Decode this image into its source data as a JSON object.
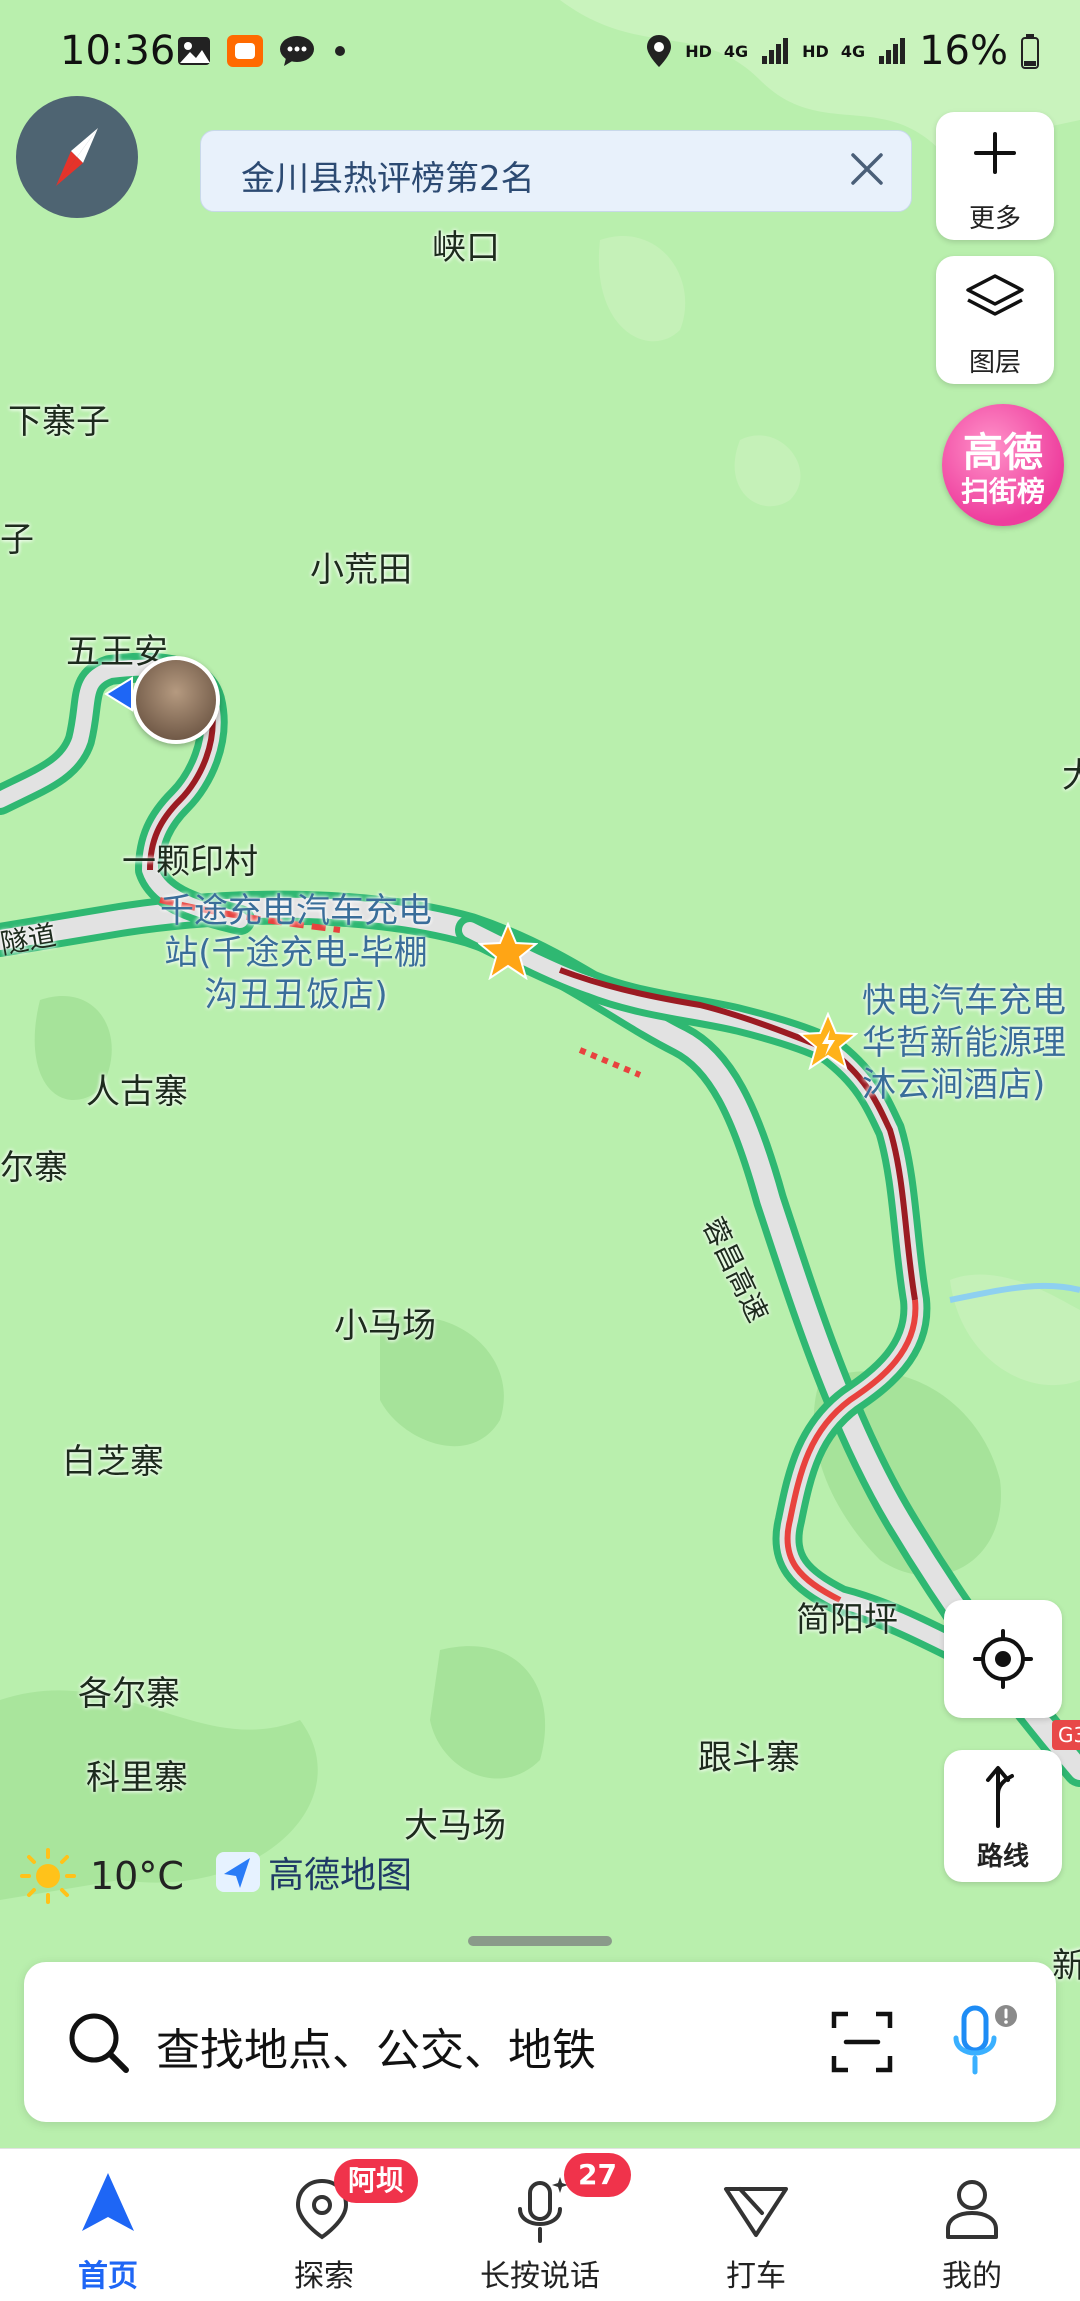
{
  "status_bar": {
    "time": "10:36",
    "network_hd_1": "HD",
    "network_4g_1": "4G",
    "network_hd_2": "HD",
    "network_4g_2": "4G",
    "battery": "16%"
  },
  "banner": {
    "text": "金川县热评榜第2名"
  },
  "side_buttons": {
    "more": "更多",
    "layers": "图层",
    "locate": "",
    "route": "路线"
  },
  "gaode_badge": {
    "line1": "高德",
    "line2": "扫街榜"
  },
  "map_labels": {
    "xiakou": "峡口",
    "xiazhaizi": "下寨子",
    "zi": "子",
    "xiaohuangtian": "小荒田",
    "wuwangan": "五王安",
    "yikeyincun": "一颗印村",
    "suidao": "隧道",
    "rengzhai": "人古寨",
    "erzhai": "尔寨",
    "xiaomachang": "小马场",
    "baizhizhai": "白芝寨",
    "geerzhai": "各尔寨",
    "kelizhai": "科里寨",
    "damachang": "大马场",
    "gendouzhai": "跟斗寨",
    "jianyangping": "简阳坪",
    "highway": "蓉昌高速",
    "da_edge": "大",
    "xin_edge": "新",
    "g_edge": "G3"
  },
  "pois": {
    "qiantu_1": "千途充电汽车充电",
    "qiantu_2": "站(千途充电-毕棚",
    "qiantu_3": "沟丑丑饭店)",
    "kuaidian_1": "快电汽车充电",
    "kuaidian_2": "华哲新能源理",
    "kuaidian_3": "沐云涧酒店)"
  },
  "weather": {
    "temp": "10°C"
  },
  "brand": {
    "name": "高德地图"
  },
  "search": {
    "placeholder": "查找地点、公交、地铁"
  },
  "tabs": [
    {
      "label": "首页",
      "badge": ""
    },
    {
      "label": "探索",
      "badge": "阿坝"
    },
    {
      "label": "长按说话",
      "badge": "27"
    },
    {
      "label": "打车",
      "badge": ""
    },
    {
      "label": "我的",
      "badge": ""
    }
  ],
  "colors": {
    "map_bg": "#b9efad",
    "road_green": "#2fb872",
    "road_dark_red": "#9b1b22",
    "road_red": "#e8423e",
    "accent_blue": "#1e66f5",
    "badge_red": "#f0334b"
  }
}
